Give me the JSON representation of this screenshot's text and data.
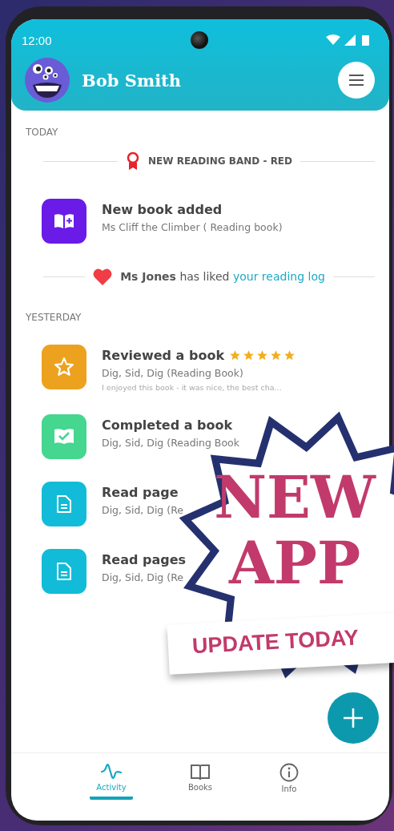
{
  "status_bar": {
    "time": "12:00"
  },
  "header": {
    "user_name": "Bob Smith"
  },
  "sections": [
    {
      "label": "TODAY",
      "items": [
        {
          "kind": "event",
          "text": "**NEW READING BAND - RED**"
        },
        {
          "kind": "book_added",
          "color": "#6a1be8",
          "title": "New book added",
          "subtitle": "Ms Cliff the Climber ( Reading book)"
        },
        {
          "kind": "like",
          "text": "**Ms Jones** has liked",
          "link": "your reading log"
        }
      ]
    },
    {
      "label": "YESTERDAY",
      "items": [
        {
          "kind": "review",
          "color": "#eca21f",
          "title": "Reviewed a book",
          "stars": 5,
          "subtitle": "Dig, Sid, Dig (Reading Book)",
          "note": "I enjoyed this book - it was nice, the best cha..."
        },
        {
          "kind": "completed",
          "color": "#45d68f",
          "title": "Completed a book",
          "subtitle": "Dig, Sid, Dig (Reading Book"
        },
        {
          "kind": "reading",
          "color": "#12bcd8",
          "title": "Read page",
          "subtitle": "Dig, Sid, Dig (Re"
        },
        {
          "kind": "reading",
          "color": "#12bcd8",
          "title": "Read pages",
          "subtitle": "Dig, Sid, Dig (Re"
        }
      ]
    }
  ],
  "promo": {
    "headline": [
      "NEW",
      "APP"
    ],
    "banner": "UPDATE TODAY"
  },
  "tabs": [
    {
      "label": "Activity",
      "selected": true
    },
    {
      "label": "Books",
      "selected": false
    },
    {
      "label": "Info",
      "selected": false
    }
  ]
}
